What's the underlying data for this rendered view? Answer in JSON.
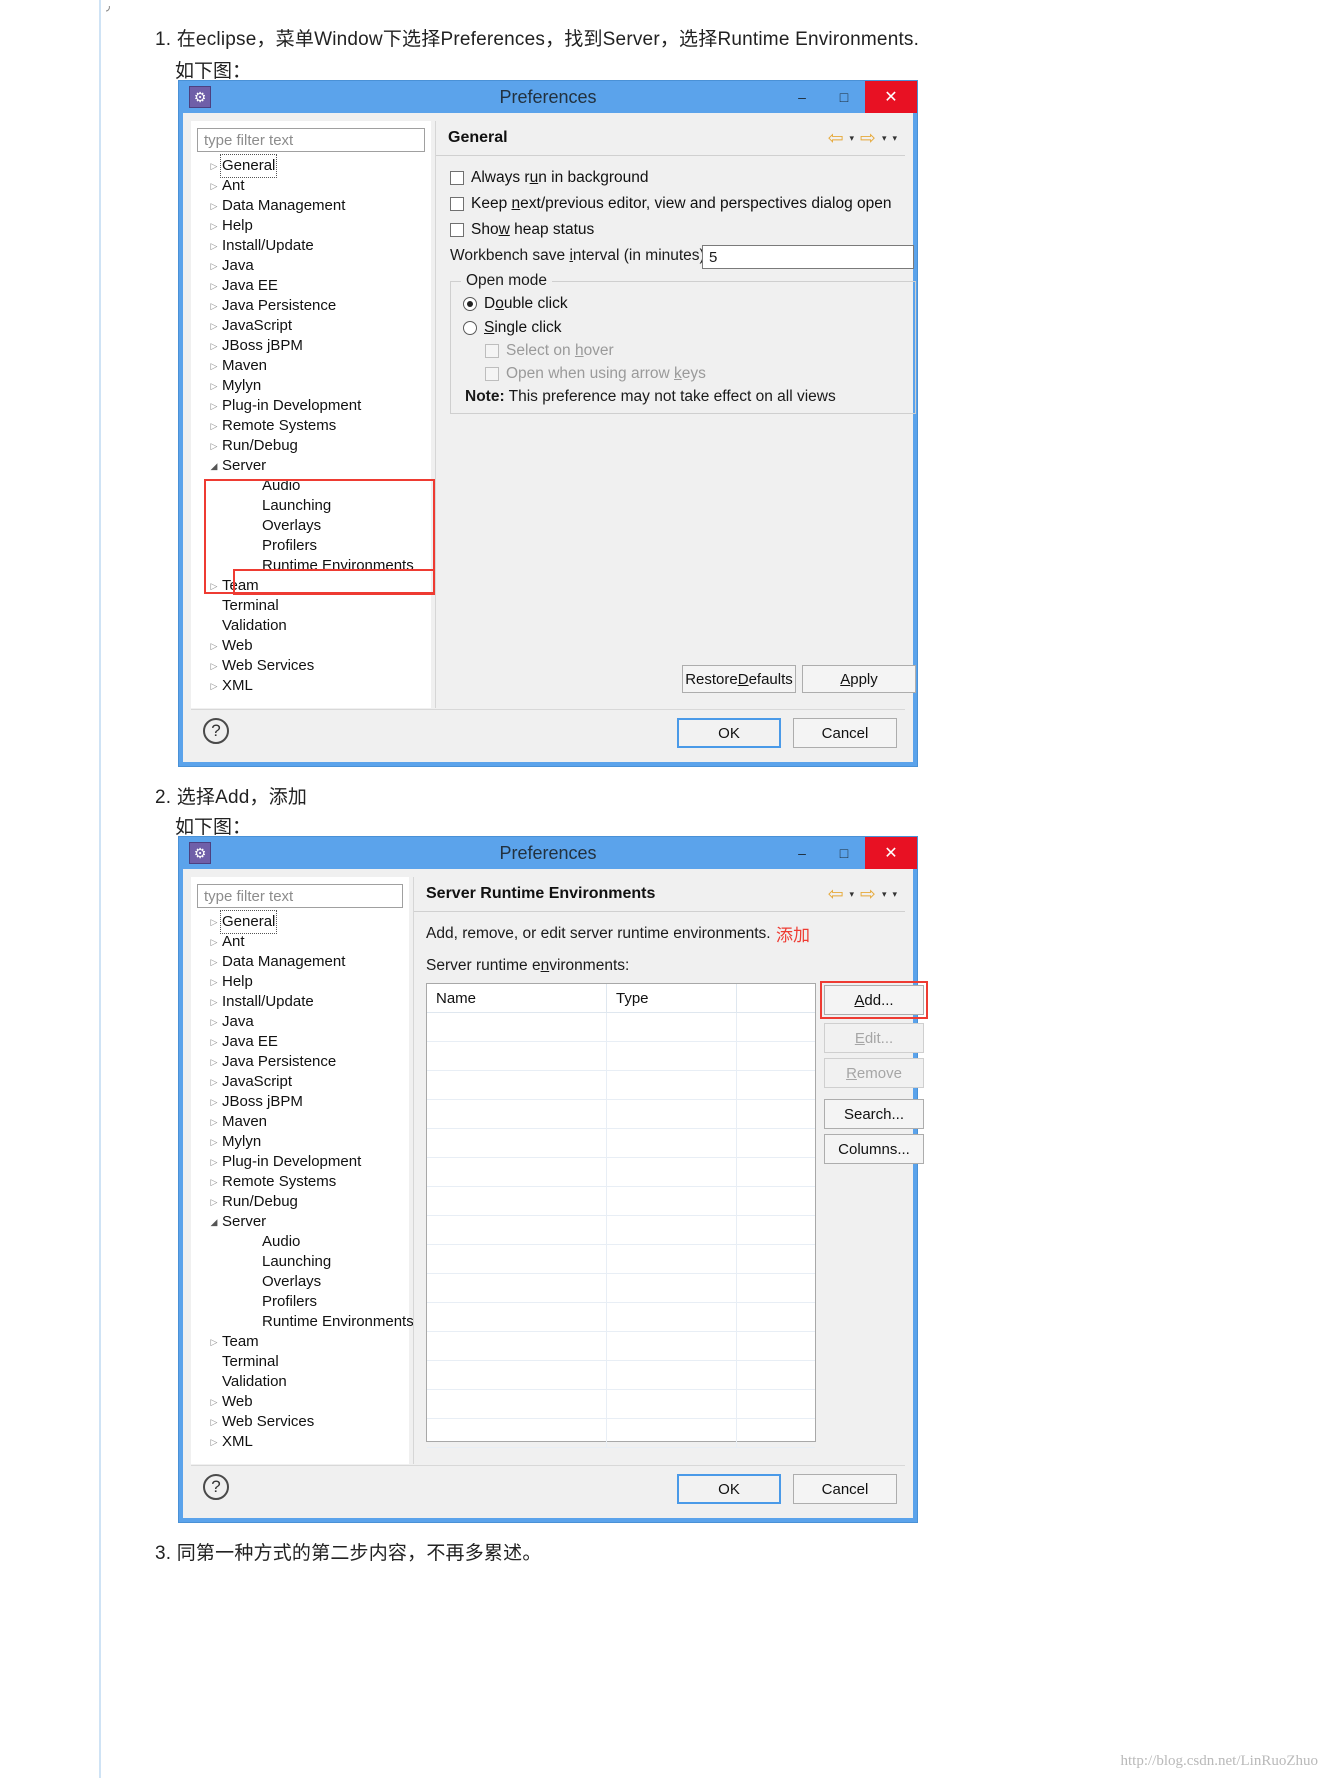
{
  "article": {
    "step1": "1. 在eclipse，菜单Window下选择Preferences，找到Server，选择Runtime Environments.",
    "step1_sub": "如下图：",
    "step2": "2. 选择Add，添加",
    "step2_sub": "如下图：",
    "step3": "3. 同第一种方式的第二步内容，不再多累述。",
    "watermark": "http://blog.csdn.net/LinRuoZhuo"
  },
  "dialog1": {
    "title": "Preferences",
    "titlebar_icon": "eclipse-preferences-icon",
    "minimize": "–",
    "maximize": "□",
    "close": "✕",
    "filter_placeholder": "type filter text",
    "tree": [
      {
        "label": "General",
        "level": 1,
        "twisty": "collapsed",
        "focused": true
      },
      {
        "label": "Ant",
        "level": 1,
        "twisty": "collapsed"
      },
      {
        "label": "Data Management",
        "level": 1,
        "twisty": "collapsed"
      },
      {
        "label": "Help",
        "level": 1,
        "twisty": "collapsed"
      },
      {
        "label": "Install/Update",
        "level": 1,
        "twisty": "collapsed"
      },
      {
        "label": "Java",
        "level": 1,
        "twisty": "collapsed"
      },
      {
        "label": "Java EE",
        "level": 1,
        "twisty": "collapsed"
      },
      {
        "label": "Java Persistence",
        "level": 1,
        "twisty": "collapsed"
      },
      {
        "label": "JavaScript",
        "level": 1,
        "twisty": "collapsed"
      },
      {
        "label": "JBoss jBPM",
        "level": 1,
        "twisty": "collapsed"
      },
      {
        "label": "Maven",
        "level": 1,
        "twisty": "collapsed"
      },
      {
        "label": "Mylyn",
        "level": 1,
        "twisty": "collapsed"
      },
      {
        "label": "Plug-in Development",
        "level": 1,
        "twisty": "collapsed"
      },
      {
        "label": "Remote Systems",
        "level": 1,
        "twisty": "collapsed"
      },
      {
        "label": "Run/Debug",
        "level": 1,
        "twisty": "collapsed"
      },
      {
        "label": "Server",
        "level": 1,
        "twisty": "expanded"
      },
      {
        "label": "Audio",
        "level": 2,
        "twisty": "none"
      },
      {
        "label": "Launching",
        "level": 2,
        "twisty": "none"
      },
      {
        "label": "Overlays",
        "level": 2,
        "twisty": "none"
      },
      {
        "label": "Profilers",
        "level": 2,
        "twisty": "none"
      },
      {
        "label": "Runtime Environments",
        "level": 2,
        "twisty": "none"
      },
      {
        "label": "Team",
        "level": 1,
        "twisty": "collapsed"
      },
      {
        "label": "Terminal",
        "level": 1,
        "twisty": "none"
      },
      {
        "label": "Validation",
        "level": 1,
        "twisty": "none"
      },
      {
        "label": "Web",
        "level": 1,
        "twisty": "collapsed"
      },
      {
        "label": "Web Services",
        "level": 1,
        "twisty": "collapsed"
      },
      {
        "label": "XML",
        "level": 1,
        "twisty": "collapsed"
      }
    ],
    "page_title": "General",
    "nav": {
      "back": "⇦",
      "back_caret": "▾",
      "forward": "⇨",
      "forward_caret": "▾",
      "menu_caret": "▾"
    },
    "checkboxes": [
      {
        "label_pre": "Always r",
        "accel": "u",
        "label_post": "n in background",
        "checked": false
      },
      {
        "label_pre": "Keep ",
        "accel": "n",
        "label_post": "ext/previous editor, view and perspectives dialog open",
        "checked": false
      },
      {
        "label_pre": "Show",
        "accel": "w",
        "label_post": " heap status",
        "checked": false
      }
    ],
    "save_interval": {
      "label_pre": "Workbench save ",
      "accel": "i",
      "label_post": "nterval (in minutes):",
      "value": "5"
    },
    "open_mode": {
      "title": "Open mode",
      "double_click": {
        "pre": "D",
        "accel": "o",
        "post": "uble click",
        "selected": true
      },
      "single_click": {
        "pre": "",
        "accel": "S",
        "post": "ingle click",
        "selected": false
      },
      "select_on_hover": {
        "pre": "Select on ",
        "accel": "h",
        "post": "over",
        "enabled": false,
        "checked": false
      },
      "open_arrow_keys": {
        "pre": "Open when using arrow ",
        "accel": "k",
        "post": "eys",
        "enabled": false,
        "checked": false
      },
      "note_label": "Note:",
      "note_text": "This preference may not take effect on all views"
    },
    "restore_defaults": {
      "pre": "Restore ",
      "accel": "D",
      "post": "efaults"
    },
    "apply": {
      "pre": "",
      "accel": "A",
      "post": "pply"
    },
    "ok": "OK",
    "cancel": "Cancel",
    "help": "?"
  },
  "dialog2": {
    "title": "Preferences",
    "filter_placeholder": "type filter text",
    "page_title": "Server Runtime Environments",
    "description": "Add, remove, or edit server runtime environments.",
    "list_label": {
      "pre": "Server runtime e",
      "accel": "n",
      "post": "vironments:"
    },
    "annotation_add": "添加",
    "table": {
      "columns": [
        "Name",
        "Type",
        ""
      ],
      "rows": []
    },
    "buttons": [
      {
        "pre": "",
        "accel": "A",
        "post": "dd...",
        "enabled": true,
        "highlighted": true
      },
      {
        "pre": "",
        "accel": "E",
        "post": "dit...",
        "enabled": false,
        "highlighted": false
      },
      {
        "pre": "",
        "accel": "R",
        "post": "emove",
        "enabled": false,
        "highlighted": false
      },
      {
        "pre": "Search",
        "accel": "",
        "post": "...",
        "enabled": true,
        "highlighted": false
      },
      {
        "pre": "Columns",
        "accel": "",
        "post": "...",
        "enabled": true,
        "highlighted": false
      }
    ],
    "ok": "OK",
    "cancel": "Cancel",
    "help": "?"
  }
}
